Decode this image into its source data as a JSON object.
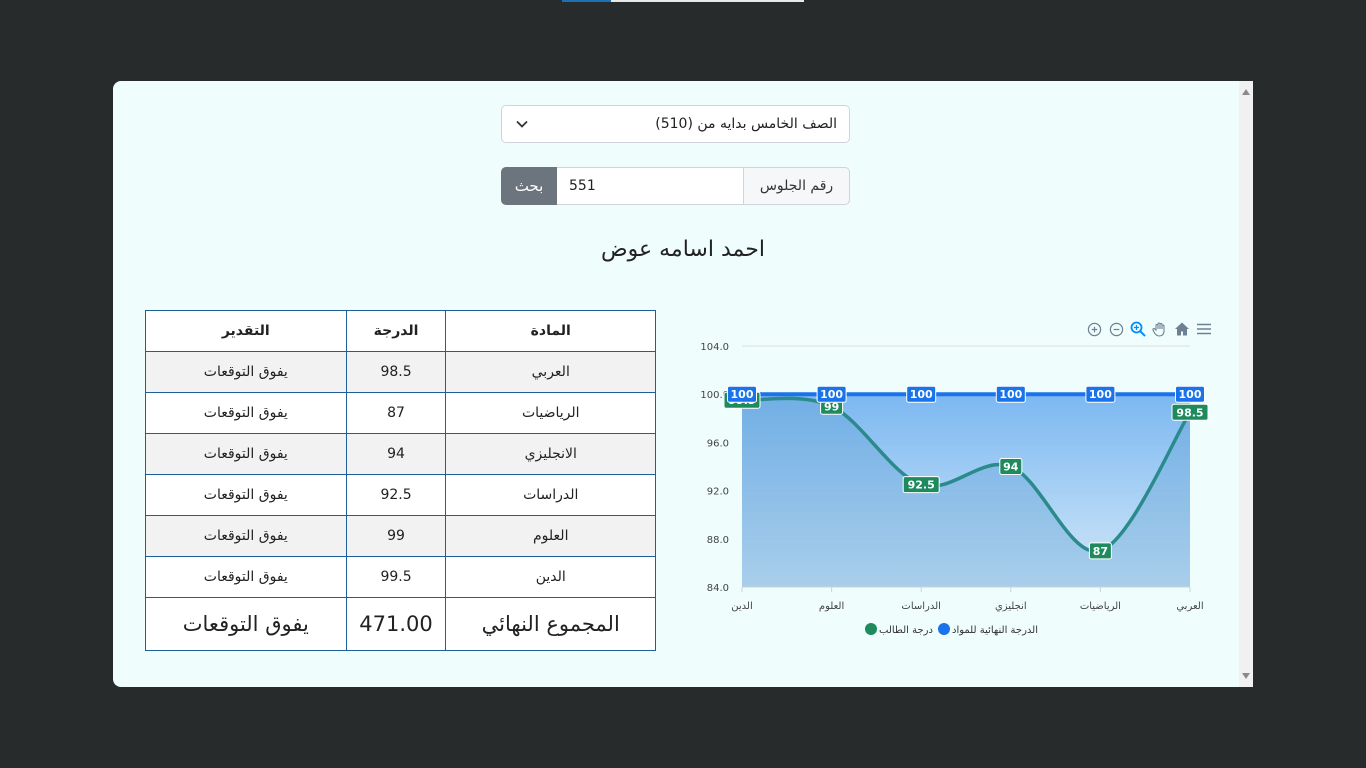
{
  "form": {
    "grade_select_value": "الصف الخامس بدايه من (510)",
    "search_button": "بحث",
    "seat_number_value": "551",
    "seat_number_label": "رقم الجلوس"
  },
  "student": {
    "name": "احمد اسامه عوض"
  },
  "table": {
    "headers": {
      "subject": "المادة",
      "score": "الدرجة",
      "rating": "التقدير"
    },
    "rows": [
      {
        "subject": "العربي",
        "score": "98.5",
        "rating": "يفوق التوقعات"
      },
      {
        "subject": "الرياضيات",
        "score": "87",
        "rating": "يفوق التوقعات"
      },
      {
        "subject": "الانجليزي",
        "score": "94",
        "rating": "يفوق التوقعات"
      },
      {
        "subject": "الدراسات",
        "score": "92.5",
        "rating": "يفوق التوقعات"
      },
      {
        "subject": "العلوم",
        "score": "99",
        "rating": "يفوق التوقعات"
      },
      {
        "subject": "الدين",
        "score": "99.5",
        "rating": "يفوق التوقعات"
      }
    ],
    "total": {
      "label": "المجموع النهائي",
      "value": "471.00",
      "rating": "يفوق التوقعات"
    }
  },
  "toolbar_icons": [
    "zoom-in-icon",
    "zoom-out-icon",
    "selection-zoom-icon",
    "pan-hand-icon",
    "home-reset-icon",
    "menu-icon"
  ],
  "chart_data": {
    "type": "area",
    "categories": [
      "الدين",
      "العلوم",
      "الدراسات",
      "انجليزي",
      "الرياضيات",
      "العربي"
    ],
    "series": [
      {
        "name": "الدرجة النهائية للمواد",
        "color": "#1a73e8",
        "values": [
          100,
          100,
          100,
          100,
          100,
          100
        ]
      },
      {
        "name": "درجة الطالب",
        "color": "#1e8a5e",
        "values": [
          99.5,
          99,
          92.5,
          94,
          87,
          98.5
        ]
      }
    ],
    "ylim": [
      84,
      104
    ],
    "yticks": [
      "84.0",
      "88.0",
      "92.0",
      "96.0",
      "100.0",
      "104.0"
    ],
    "grid": true,
    "legend": "bottom",
    "area_color": "#6fb0f0"
  }
}
